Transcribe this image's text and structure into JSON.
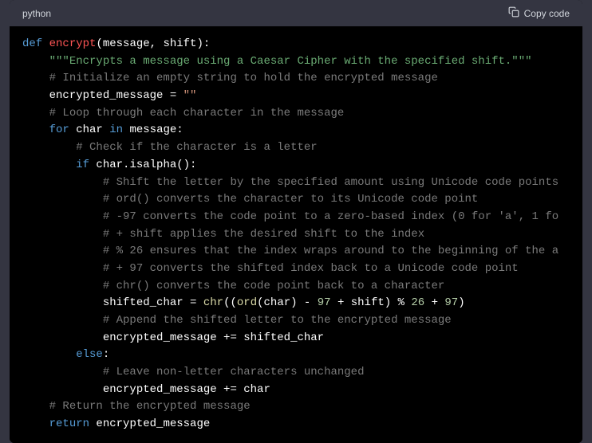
{
  "header": {
    "language": "python",
    "copy_label": "Copy code"
  },
  "code": {
    "l1_def": "def",
    "l1_fn": "encrypt",
    "l1_rest": "(message, shift):",
    "l2": "\"\"\"Encrypts a message using a Caesar Cipher with the specified shift.\"\"\"",
    "l3": "# Initialize an empty string to hold the encrypted message",
    "l4a": "encrypted_message = ",
    "l4b": "\"\"",
    "l5": "# Loop through each character in the message",
    "l6a": "for",
    "l6b": " char ",
    "l6c": "in",
    "l6d": " message:",
    "l7": "# Check if the character is a letter",
    "l8a": "if",
    "l8b": " char.isalpha():",
    "l9": "# Shift the letter by the specified amount using Unicode code points",
    "l10": "# ord() converts the character to its Unicode code point",
    "l11": "# -97 converts the code point to a zero-based index (0 for 'a', 1 fo",
    "l12": "# + shift applies the desired shift to the index",
    "l13": "# % 26 ensures that the index wraps around to the beginning of the a",
    "l14": "# + 97 converts the shifted index back to a Unicode code point",
    "l15": "# chr() converts the code point back to a character",
    "l16a": "shifted_char = ",
    "l16b": "chr",
    "l16c": "((",
    "l16d": "ord",
    "l16e": "(char) - ",
    "l16f": "97",
    "l16g": " + shift) % ",
    "l16h": "26",
    "l16i": " + ",
    "l16j": "97",
    "l16k": ")",
    "l17": "# Append the shifted letter to the encrypted message",
    "l18": "encrypted_message += shifted_char",
    "l19a": "else",
    "l19b": ":",
    "l20": "# Leave non-letter characters unchanged",
    "l21": "encrypted_message += char",
    "l22": "# Return the encrypted message",
    "l23a": "return",
    "l23b": " encrypted_message"
  }
}
